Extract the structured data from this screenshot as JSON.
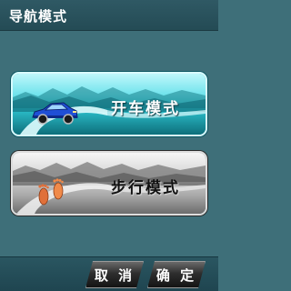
{
  "header": {
    "title": "导航模式"
  },
  "modes": [
    {
      "label": "开车模式",
      "icon": "car-icon"
    },
    {
      "label": "步行模式",
      "icon": "footprints-icon"
    }
  ],
  "softkeys": {
    "cancel": "取 消",
    "confirm": "确 定"
  },
  "colors": {
    "background": "#3e6f79",
    "drive_accent": "#2bbcc8",
    "walk_accent": "#9a9a9a"
  }
}
